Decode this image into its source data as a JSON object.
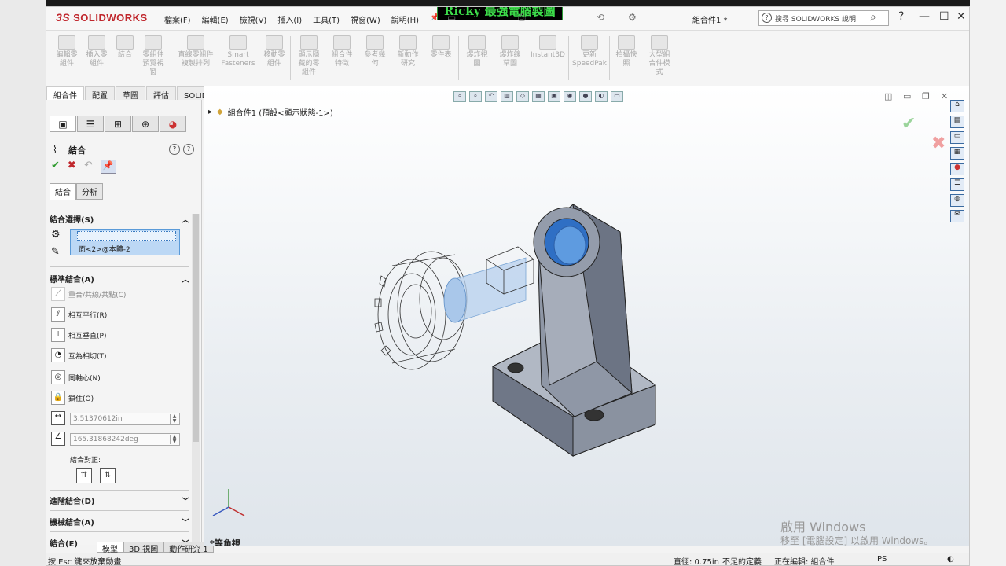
{
  "app": {
    "brand": "SOLIDWORKS",
    "brand_prefix": "3S",
    "watermark": "Ricky 最強電腦製圖",
    "doc_title": "組合件1 *",
    "search_placeholder": "搜尋 SOLIDWORKS 說明"
  },
  "menus": [
    "檔案(F)",
    "編輯(E)",
    "檢視(V)",
    "插入(I)",
    "工具(T)",
    "視窗(W)",
    "說明(H)"
  ],
  "ribbon": [
    {
      "label": "編輯零\n組件"
    },
    {
      "label": "插入零\n組件"
    },
    {
      "label": "結合"
    },
    {
      "label": "零組件\n預覽視\n窗"
    },
    {
      "label": "直線零組件\n複製排列"
    },
    {
      "label": "Smart\nFasteners"
    },
    {
      "label": "移動零\n組件"
    },
    {
      "label": "顯示隱\n藏的零\n組件"
    },
    {
      "label": "組合件\n特徵"
    },
    {
      "label": "參考幾\n何"
    },
    {
      "label": "新動作\n研究"
    },
    {
      "label": "零件表"
    },
    {
      "label": "爆炸視\n圖"
    },
    {
      "label": "爆炸線\n草圖"
    },
    {
      "label": "Instant3D"
    },
    {
      "label": "更新\nSpeedPak"
    },
    {
      "label": "拍攝快\n照"
    },
    {
      "label": "大型組\n合件模\n式"
    }
  ],
  "command_tabs": [
    "組合件",
    "配置",
    "草圖",
    "評估",
    "SOLIDWORKS 附加程式"
  ],
  "property_manager": {
    "title": "結合",
    "subtabs": [
      "結合",
      "分析"
    ],
    "mate_selection_title": "結合選擇(S)",
    "mate_selection_item": "面<2>@本體-2",
    "standard_title": "標準結合(A)",
    "mates": [
      {
        "label": "重合/共線/共點(C)",
        "icon": "coincident-icon"
      },
      {
        "label": "相互平行(R)",
        "icon": "parallel-icon"
      },
      {
        "label": "相互垂直(P)",
        "icon": "perpendicular-icon"
      },
      {
        "label": "互為相切(T)",
        "icon": "tangent-icon"
      },
      {
        "label": "同軸心(N)",
        "icon": "concentric-icon"
      },
      {
        "label": "鎖住(O)",
        "icon": "lock-icon"
      }
    ],
    "distance_value": "3.51370612in",
    "angle_value": "165.31868242deg",
    "alignment_label": "結合對正:",
    "advanced_title": "進階結合(D)",
    "mechanical_title": "機械結合(A)",
    "mates_title": "結合(E)"
  },
  "bottom_tabs": [
    "模型",
    "3D 視圖",
    "動作研究 1"
  ],
  "viewport": {
    "tree_item": "組合件1 (預設<顯示狀態-1>)",
    "view_label": "*等角視",
    "activate_title": "啟用 Windows",
    "activate_sub": "移至 [電腦設定] 以啟用 Windows。"
  },
  "status": {
    "hint": "按 Esc 鍵來放棄動畫",
    "diameter": "直徑: 0.75in",
    "definition": "不足的定義",
    "editing": "正在編輯: 組合件",
    "units": "IPS"
  }
}
